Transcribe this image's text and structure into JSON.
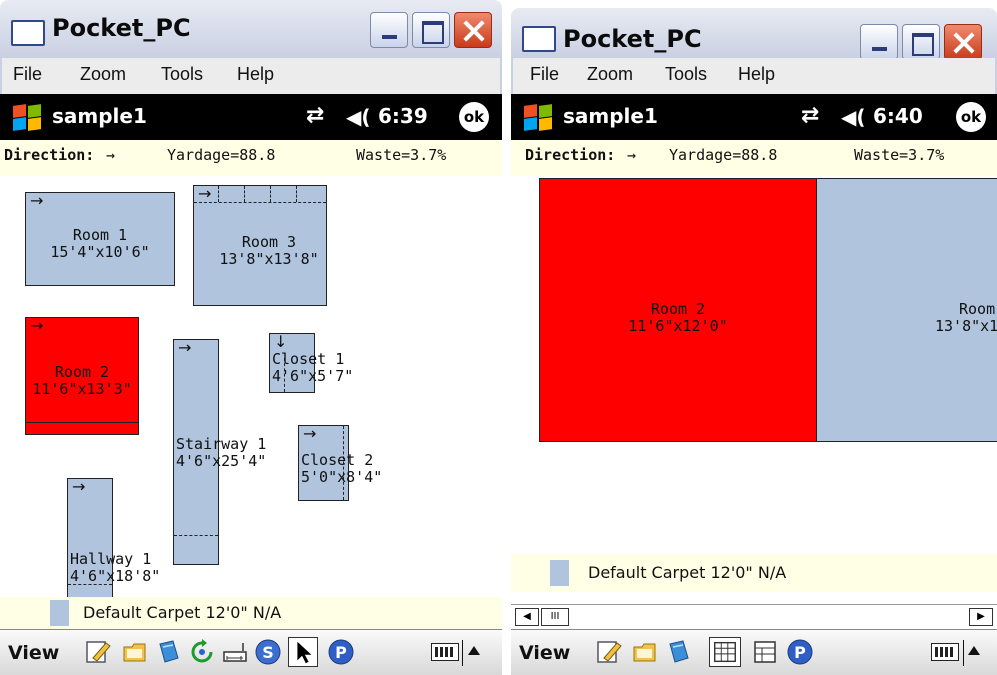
{
  "windows": [
    {
      "title": "Pocket_PC",
      "menu": [
        "File",
        "Zoom",
        "Tools",
        "Help"
      ],
      "nav": {
        "app_title": "sample1",
        "time": "6:39",
        "ok_label": "ok"
      },
      "info": {
        "direction_label": "Direction:",
        "direction_arrow": "→",
        "yardage": "Yardage=88.8",
        "waste": "Waste=3.7%"
      },
      "rooms": [
        {
          "name": "Room 1",
          "size": "15'4\"x10'6\"",
          "arrow": "→"
        },
        {
          "name": "Room 3",
          "size": "13'8\"x13'8\"",
          "arrow": "→"
        },
        {
          "name": "Room 2",
          "size": "11'6\"x13'3\"",
          "arrow": "→"
        },
        {
          "name": "Stairway 1",
          "size": "4'6\"x25'4\"",
          "arrow": "→"
        },
        {
          "name": "Closet 1",
          "size": "4'6\"x5'7\"",
          "arrow": "↓"
        },
        {
          "name": "Closet 2",
          "size": "5'0\"x8'4\"",
          "arrow": "→"
        },
        {
          "name": "Hallway 1",
          "size": "4'6\"x18'8\"",
          "arrow": "→"
        }
      ],
      "legend": {
        "text": "Default Carpet 12'0\" N/A"
      },
      "toolbar": {
        "view_label": "View"
      }
    },
    {
      "title": "Pocket_PC",
      "menu": [
        "File",
        "Zoom",
        "Tools",
        "Help"
      ],
      "nav": {
        "app_title": "sample1",
        "time": "6:40",
        "ok_label": "ok"
      },
      "info": {
        "direction_label": "Direction:",
        "direction_arrow": "→",
        "yardage": "Yardage=88.8",
        "waste": "Waste=3.7%"
      },
      "rooms": [
        {
          "name": "Room 2",
          "size": "11'6\"x12'0\""
        },
        {
          "name": "Room",
          "size": "13'8\"x1"
        }
      ],
      "legend": {
        "text": "Default Carpet 12'0\" N/A"
      },
      "scrollbar": {
        "left_arrow": "◀",
        "thumb": "III",
        "right_arrow": "▶"
      },
      "toolbar": {
        "view_label": "View"
      }
    }
  ],
  "colors": {
    "selected_room": "#ff0000",
    "room_fill": "#b0c4de",
    "info_bar": "#ffffe6",
    "nav_bar": "#000000"
  },
  "icons": {
    "toolbar_left": [
      "edit-pencil-icon",
      "folder-icon",
      "book-icon",
      "rotate-icon",
      "dimension-icon",
      "s-circle-icon",
      "pointer-arrow-icon",
      "p-circle-icon",
      "keyboard-icon",
      "up-arrow-icon"
    ],
    "toolbar_right": [
      "edit-pencil-icon",
      "folder-icon",
      "book-icon",
      "grid-view-icon",
      "grid-view-2-icon",
      "p-circle-icon",
      "keyboard-icon",
      "up-arrow-icon"
    ]
  }
}
